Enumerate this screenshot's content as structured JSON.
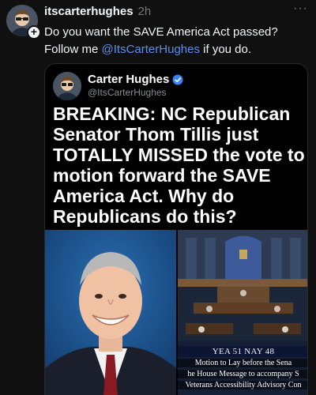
{
  "post": {
    "username": "itscarterhughes",
    "timestamp": "2h",
    "more_icon": "more-horizontal-icon",
    "text_line1": "Do you want the SAVE America Act passed?",
    "text_line2_before": "Follow me ",
    "text_line2_mention": "@ItsCarterHughes",
    "text_line2_after": " if you do.",
    "follow_icon": "plus-icon"
  },
  "quote": {
    "display_name": "Carter Hughes",
    "verified_icon": "verified-badge-icon",
    "handle": "@ItsCarterHughes",
    "headline": "BREAKING: NC Republican Senator Thom Tillis just TOTALLY MISSED the vote to motion forward the SAVE America Act. Why do Republicans do this?"
  },
  "senate_screen": {
    "tally": "YEA  51  NAY  48",
    "caption_line1": "Motion to Lay before the Sena",
    "caption_line2": "he House Message to accompany S",
    "caption_line3": "Veterans Accessibility Advisory Con"
  },
  "colors": {
    "background": "#101010",
    "mention": "#5b8ef0",
    "verified": "#3b82f6"
  }
}
